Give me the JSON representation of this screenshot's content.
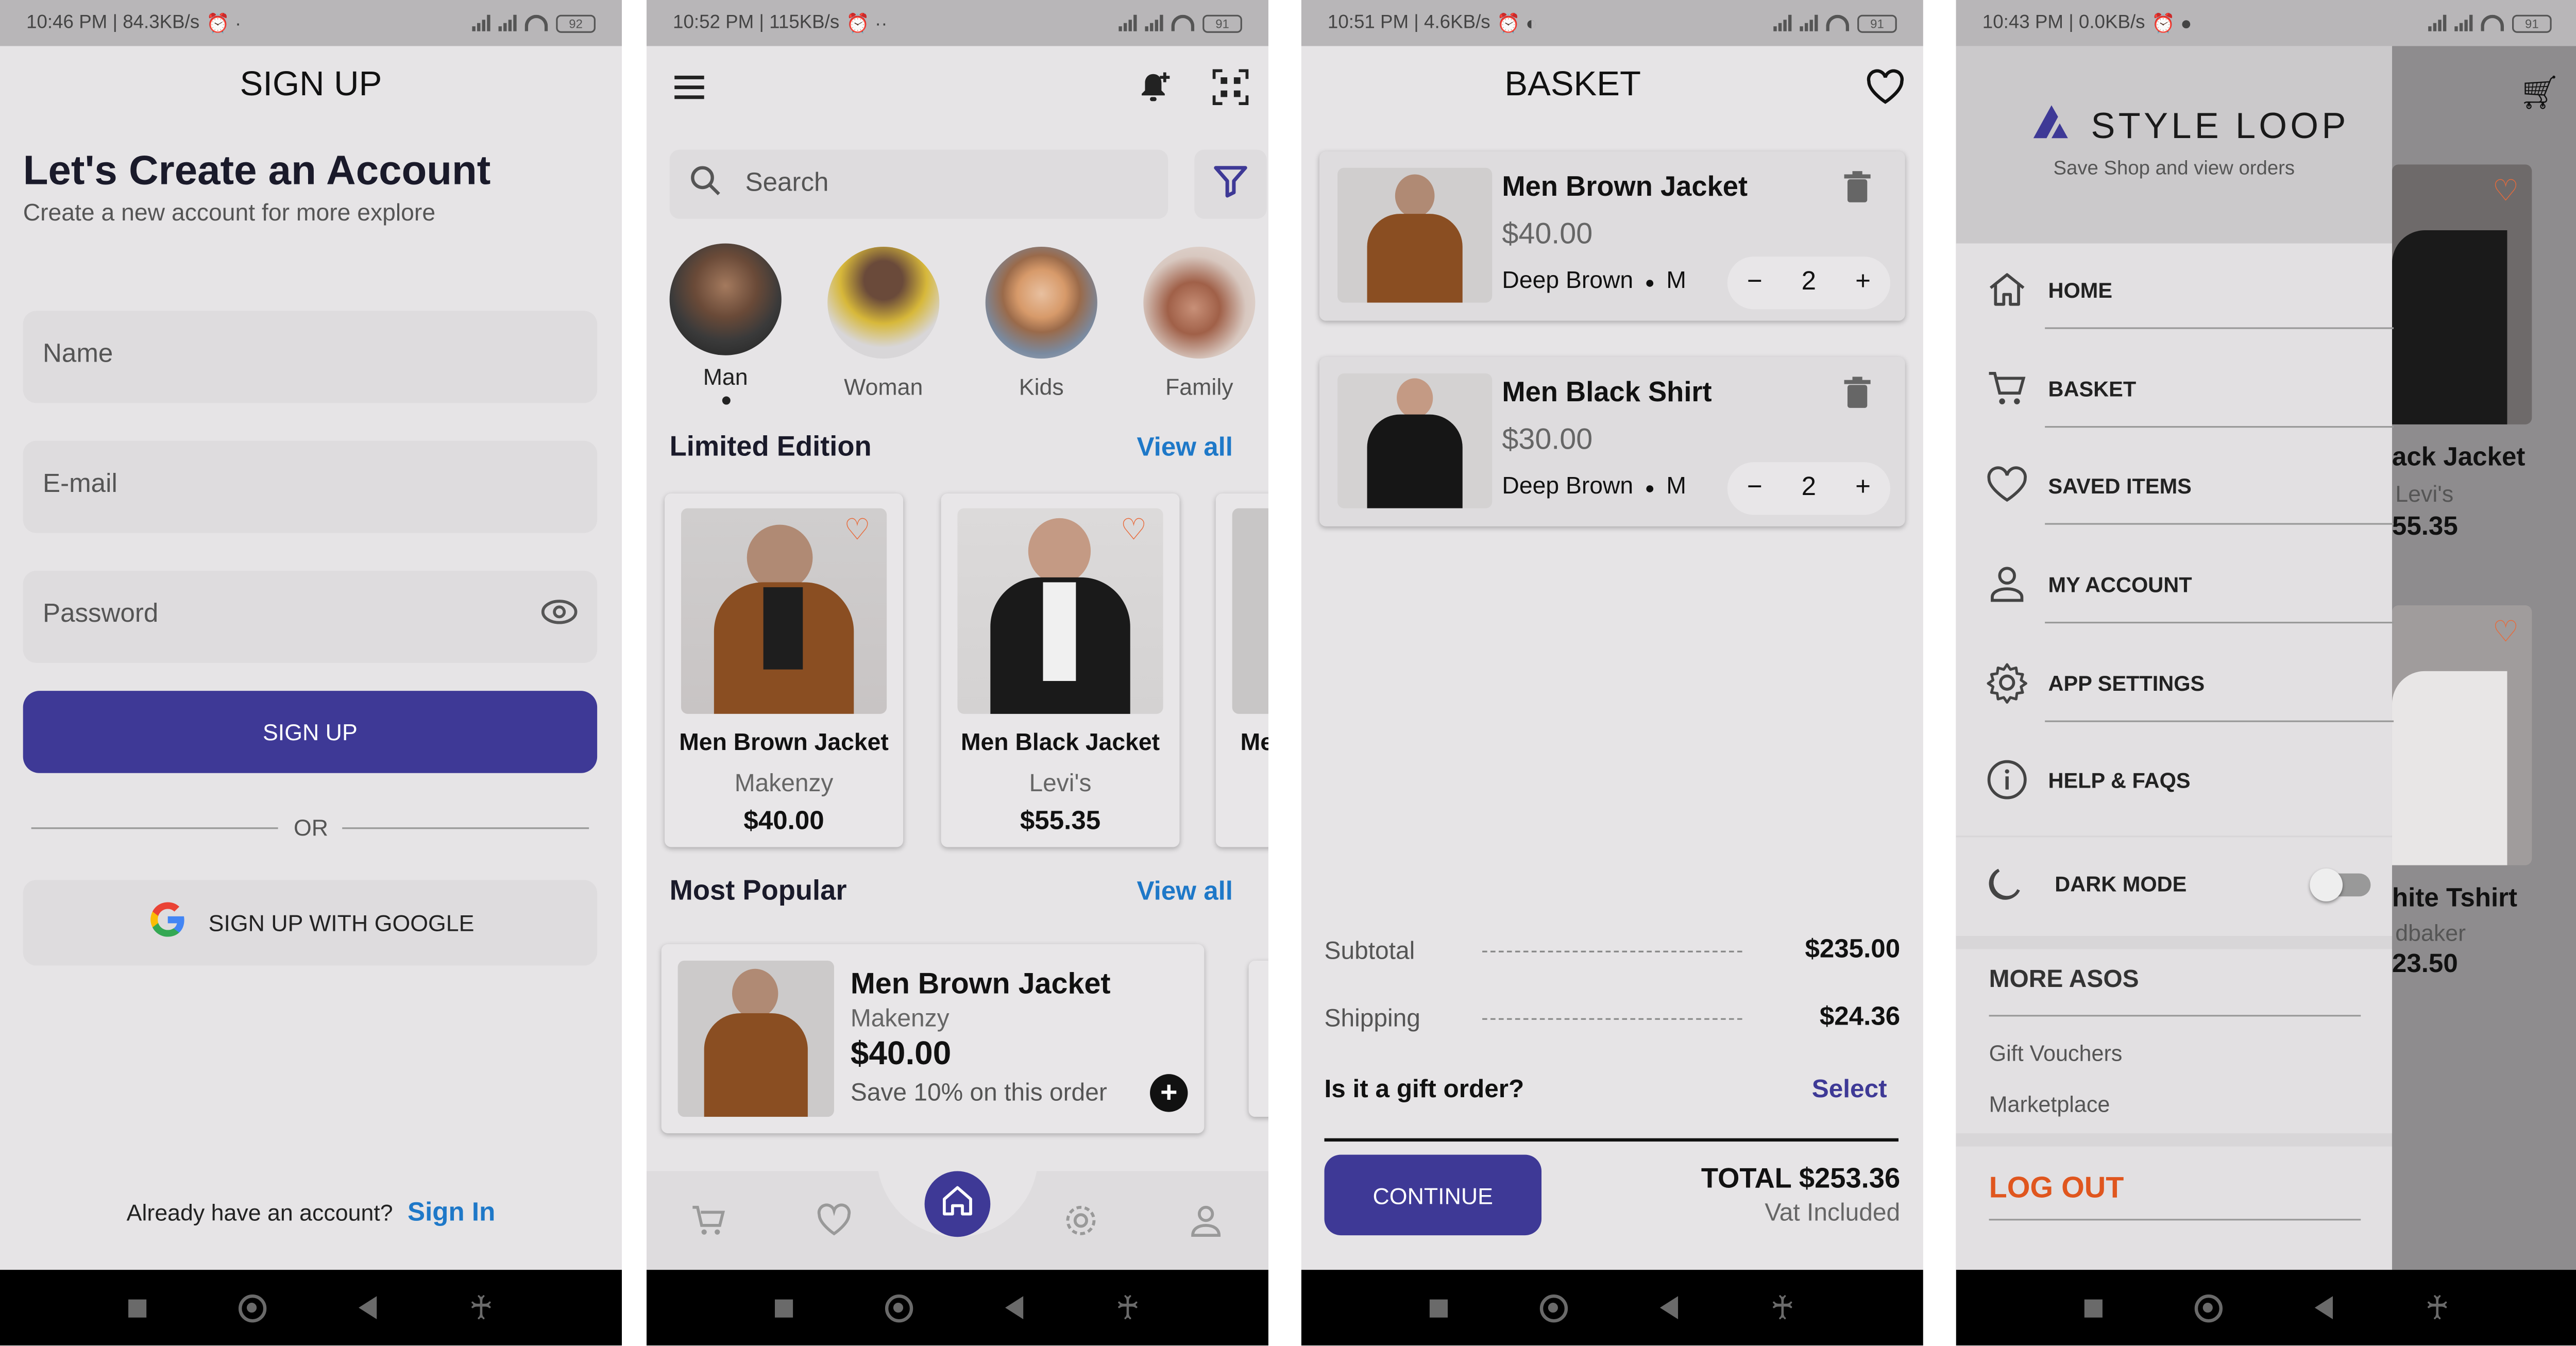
{
  "screen1": {
    "status": {
      "time": "10:46 PM | 84.3KB/s",
      "battery": "92"
    },
    "header_title": "SIGN UP",
    "heading": "Let's Create an Account",
    "subheading": "Create a new account for more explore",
    "name_placeholder": "Name",
    "email_placeholder": "E-mail",
    "password_placeholder": "Password",
    "signup_button": "SIGN UP",
    "or_label": "OR",
    "google_button": "SIGN UP WITH GOOGLE",
    "footer_text": "Already have an account?",
    "footer_link": "Sign In"
  },
  "screen2": {
    "status": {
      "time": "10:52 PM | 115KB/s",
      "battery": "91"
    },
    "search_placeholder": "Search",
    "categories": [
      {
        "label": "Man"
      },
      {
        "label": "Woman"
      },
      {
        "label": "Kids"
      },
      {
        "label": "Family"
      }
    ],
    "limited_title": "Limited Edition",
    "view_all": "View all",
    "limited_items": [
      {
        "name": "Men Brown Jacket",
        "brand": "Makenzy",
        "price": "$40.00"
      },
      {
        "name": "Men Black Jacket",
        "brand": "Levi's",
        "price": "$55.35"
      },
      {
        "name": "Me"
      }
    ],
    "popular_title": "Most Popular",
    "popular_view_all": "View all",
    "popular_item": {
      "name": "Men Brown Jacket",
      "brand": "Makenzy",
      "price": "$40.00",
      "promo": "Save 10% on this order"
    }
  },
  "screen3": {
    "status": {
      "time": "10:51 PM | 4.6KB/s",
      "battery": "91"
    },
    "title": "BASKET",
    "items": [
      {
        "name": "Men Brown Jacket",
        "price": "$40.00",
        "color": "Deep Brown",
        "size": "M",
        "qty": "2"
      },
      {
        "name": "Men Black Shirt",
        "price": "$30.00",
        "color": "Deep Brown",
        "size": "M",
        "qty": "2"
      }
    ],
    "subtotal_label": "Subtotal",
    "subtotal_value": "$235.00",
    "shipping_label": "Shipping",
    "shipping_value": "$24.36",
    "gift_label": "Is it a gift order?",
    "gift_select": "Select",
    "continue_button": "CONTINUE",
    "total": "TOTAL $253.36",
    "vat": "Vat Included"
  },
  "screen4": {
    "status": {
      "time": "10:43 PM | 0.0KB/s",
      "battery": "91"
    },
    "brand": "STYLE LOOP",
    "tagline": "Save Shop and view orders",
    "menu": [
      {
        "label": "HOME",
        "icon": "home-icon"
      },
      {
        "label": "BASKET",
        "icon": "cart-icon"
      },
      {
        "label": "SAVED ITEMS",
        "icon": "heart-icon"
      },
      {
        "label": "MY ACCOUNT",
        "icon": "person-icon"
      },
      {
        "label": "APP SETTINGS",
        "icon": "gear-icon"
      },
      {
        "label": "HELP & FAQS",
        "icon": "info-icon"
      }
    ],
    "dark_mode": "DARK MODE",
    "more_title": "MORE ASOS",
    "more_links": [
      "Gift Vouchers",
      "Marketplace"
    ],
    "logout": "LOG OUT",
    "behind": {
      "card1_name": "ack Jacket",
      "card1_brand": "Levi's",
      "card1_price": "55.35",
      "card2_name": "hite Tshirt",
      "card2_brand": "dbaker",
      "card2_price": "23.50"
    }
  },
  "colors": {
    "primary": "#3e3996",
    "link": "#1e78c8",
    "logout": "#e0561e",
    "heart": "#e86a3a"
  }
}
